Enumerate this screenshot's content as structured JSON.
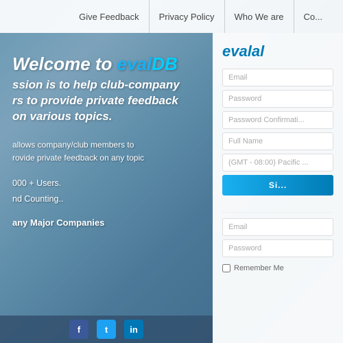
{
  "navbar": {
    "items": [
      {
        "id": "give-feedback",
        "label": "Give Feedback"
      },
      {
        "id": "privacy-policy",
        "label": "Privacy Policy"
      },
      {
        "id": "who-we-are",
        "label": "Who We are"
      },
      {
        "id": "contact",
        "label": "Co..."
      }
    ]
  },
  "hero": {
    "welcome_prefix": "Welcome to ",
    "brand_eval": "eval",
    "brand_db": "DB",
    "mission_line1": "ssion is to help club-company",
    "mission_line2": "rs to provide private feedback",
    "mission_line3": "on various topics.",
    "description_line1": "allows company/club members to",
    "description_line2": "rovide private feedback on any topic",
    "stat1": "000 + Users.",
    "stat2": "nd Counting..",
    "companies": "any Major Companies"
  },
  "form_card": {
    "brand_eval": "eval",
    "register": {
      "email_placeholder": "Email",
      "password_placeholder": "Password",
      "password_confirm_placeholder": "Password Confirmati...",
      "fullname_placeholder": "Full Name",
      "timezone_placeholder": "(GMT - 08:00) Pacific ...",
      "signup_label": "Si..."
    },
    "login": {
      "email_placeholder": "Email",
      "password_placeholder": "Password",
      "remember_label": "Remember Me"
    }
  },
  "social": {
    "facebook": "f",
    "twitter": "t",
    "linkedin": "in"
  },
  "colors": {
    "brand_blue": "#1ab0f0",
    "brand_dark_blue": "#007bb5"
  }
}
